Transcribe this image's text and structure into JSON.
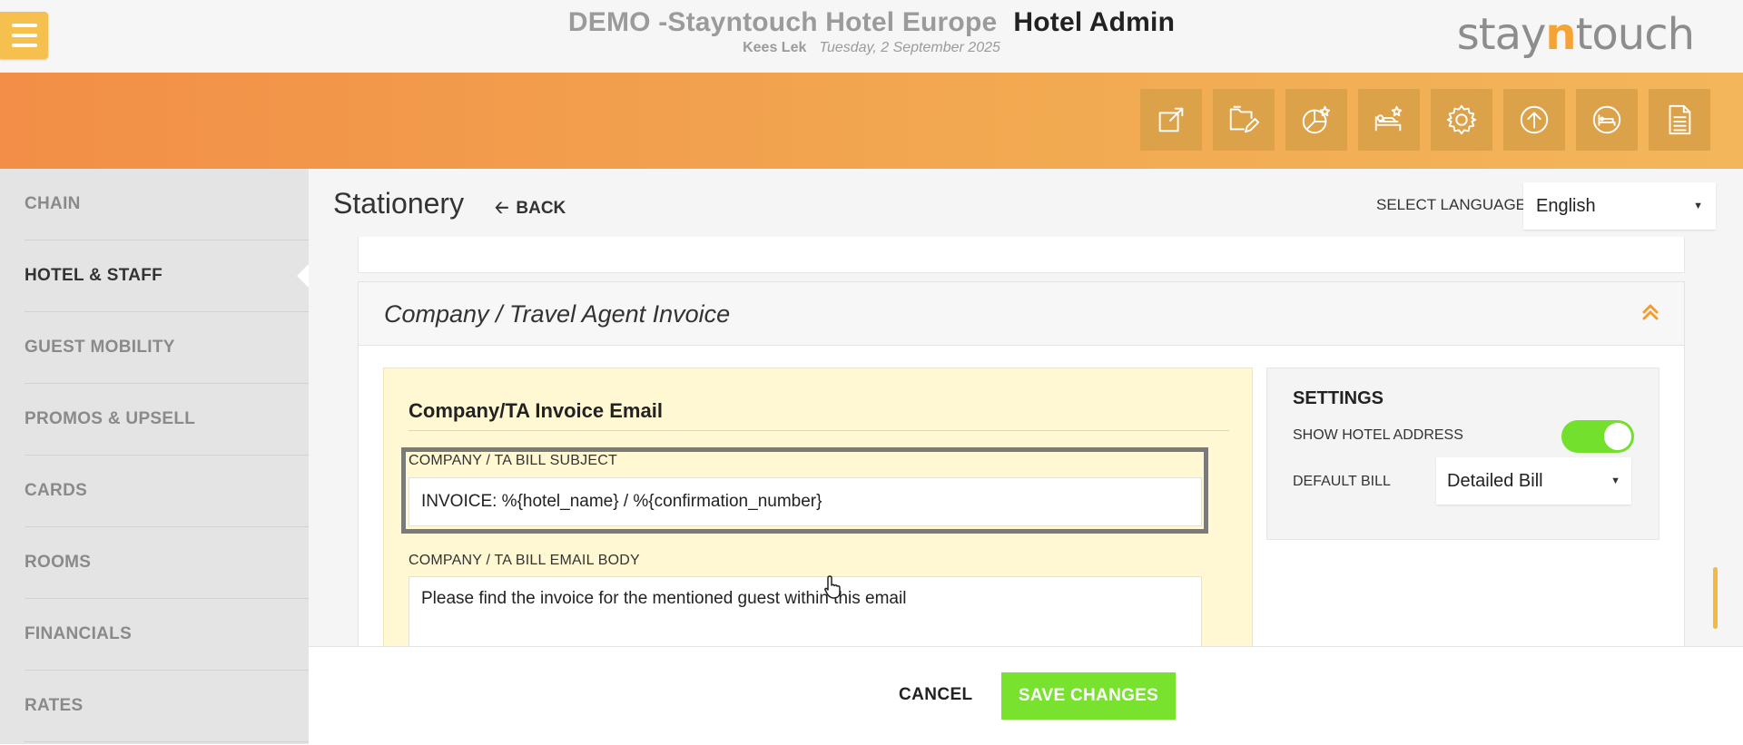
{
  "header": {
    "property": "DEMO -Stayntouch Hotel Europe",
    "app": "Hotel Admin",
    "user": "Kees Lek",
    "date": "Tuesday, 2 September 2025",
    "logo_pre": "stay",
    "logo_accent": "n",
    "logo_post": "touch"
  },
  "toolbar": {
    "icons": [
      "external-link-icon",
      "folder-edit-icon",
      "chart-star-icon",
      "bed-star-icon",
      "gear-icon",
      "upload-icon",
      "bed-icon",
      "document-icon"
    ]
  },
  "sidebar": {
    "items": [
      {
        "label": "CHAIN"
      },
      {
        "label": "HOTEL & STAFF"
      },
      {
        "label": "GUEST MOBILITY"
      },
      {
        "label": "PROMOS & UPSELL"
      },
      {
        "label": "CARDS"
      },
      {
        "label": "ROOMS"
      },
      {
        "label": "FINANCIALS"
      },
      {
        "label": "RATES"
      }
    ],
    "active": "HOTEL & STAFF"
  },
  "page": {
    "title": "Stationery",
    "back_label": "BACK",
    "language_label": "SELECT LANGUAGE",
    "language_value": "English"
  },
  "section": {
    "title": "Company / Travel Agent Invoice"
  },
  "email": {
    "title": "Company/TA Invoice Email",
    "subject_label": "COMPANY / TA BILL SUBJECT",
    "subject_value": "INVOICE: %{hotel_name} / %{confirmation_number}",
    "body_label": "COMPANY / TA BILL EMAIL BODY",
    "body_value": "Please find the invoice for the mentioned guest within this email"
  },
  "settings": {
    "title": "SETTINGS",
    "show_address_label": "SHOW HOTEL ADDRESS",
    "show_address_on": true,
    "default_bill_label": "DEFAULT BILL",
    "default_bill_value": "Detailed Bill"
  },
  "footer": {
    "cancel_label": "CANCEL",
    "save_label": "SAVE CHANGES"
  },
  "colors": {
    "accent_orange": "#f2a850",
    "toggle_green": "#72e02c",
    "save_green": "#78e22e"
  }
}
